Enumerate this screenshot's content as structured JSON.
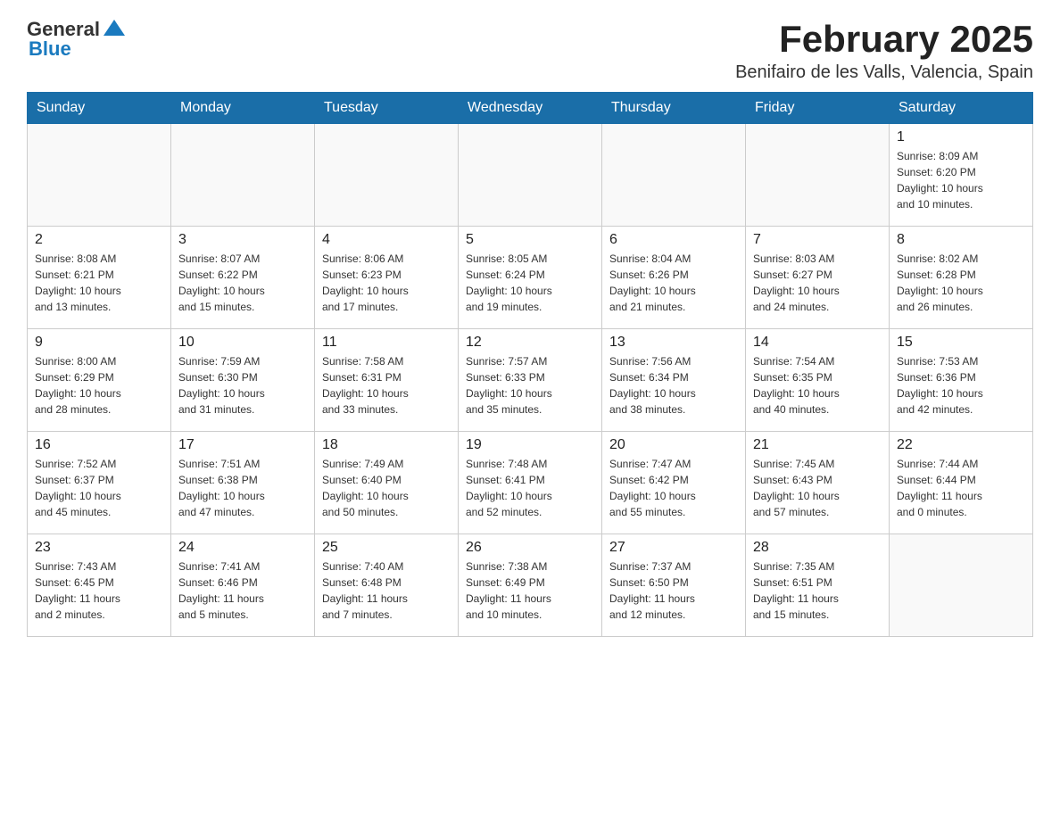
{
  "logo": {
    "general": "General",
    "blue": "Blue"
  },
  "title": "February 2025",
  "subtitle": "Benifairo de les Valls, Valencia, Spain",
  "weekdays": [
    "Sunday",
    "Monday",
    "Tuesday",
    "Wednesday",
    "Thursday",
    "Friday",
    "Saturday"
  ],
  "weeks": [
    [
      {
        "day": "",
        "info": ""
      },
      {
        "day": "",
        "info": ""
      },
      {
        "day": "",
        "info": ""
      },
      {
        "day": "",
        "info": ""
      },
      {
        "day": "",
        "info": ""
      },
      {
        "day": "",
        "info": ""
      },
      {
        "day": "1",
        "info": "Sunrise: 8:09 AM\nSunset: 6:20 PM\nDaylight: 10 hours\nand 10 minutes."
      }
    ],
    [
      {
        "day": "2",
        "info": "Sunrise: 8:08 AM\nSunset: 6:21 PM\nDaylight: 10 hours\nand 13 minutes."
      },
      {
        "day": "3",
        "info": "Sunrise: 8:07 AM\nSunset: 6:22 PM\nDaylight: 10 hours\nand 15 minutes."
      },
      {
        "day": "4",
        "info": "Sunrise: 8:06 AM\nSunset: 6:23 PM\nDaylight: 10 hours\nand 17 minutes."
      },
      {
        "day": "5",
        "info": "Sunrise: 8:05 AM\nSunset: 6:24 PM\nDaylight: 10 hours\nand 19 minutes."
      },
      {
        "day": "6",
        "info": "Sunrise: 8:04 AM\nSunset: 6:26 PM\nDaylight: 10 hours\nand 21 minutes."
      },
      {
        "day": "7",
        "info": "Sunrise: 8:03 AM\nSunset: 6:27 PM\nDaylight: 10 hours\nand 24 minutes."
      },
      {
        "day": "8",
        "info": "Sunrise: 8:02 AM\nSunset: 6:28 PM\nDaylight: 10 hours\nand 26 minutes."
      }
    ],
    [
      {
        "day": "9",
        "info": "Sunrise: 8:00 AM\nSunset: 6:29 PM\nDaylight: 10 hours\nand 28 minutes."
      },
      {
        "day": "10",
        "info": "Sunrise: 7:59 AM\nSunset: 6:30 PM\nDaylight: 10 hours\nand 31 minutes."
      },
      {
        "day": "11",
        "info": "Sunrise: 7:58 AM\nSunset: 6:31 PM\nDaylight: 10 hours\nand 33 minutes."
      },
      {
        "day": "12",
        "info": "Sunrise: 7:57 AM\nSunset: 6:33 PM\nDaylight: 10 hours\nand 35 minutes."
      },
      {
        "day": "13",
        "info": "Sunrise: 7:56 AM\nSunset: 6:34 PM\nDaylight: 10 hours\nand 38 minutes."
      },
      {
        "day": "14",
        "info": "Sunrise: 7:54 AM\nSunset: 6:35 PM\nDaylight: 10 hours\nand 40 minutes."
      },
      {
        "day": "15",
        "info": "Sunrise: 7:53 AM\nSunset: 6:36 PM\nDaylight: 10 hours\nand 42 minutes."
      }
    ],
    [
      {
        "day": "16",
        "info": "Sunrise: 7:52 AM\nSunset: 6:37 PM\nDaylight: 10 hours\nand 45 minutes."
      },
      {
        "day": "17",
        "info": "Sunrise: 7:51 AM\nSunset: 6:38 PM\nDaylight: 10 hours\nand 47 minutes."
      },
      {
        "day": "18",
        "info": "Sunrise: 7:49 AM\nSunset: 6:40 PM\nDaylight: 10 hours\nand 50 minutes."
      },
      {
        "day": "19",
        "info": "Sunrise: 7:48 AM\nSunset: 6:41 PM\nDaylight: 10 hours\nand 52 minutes."
      },
      {
        "day": "20",
        "info": "Sunrise: 7:47 AM\nSunset: 6:42 PM\nDaylight: 10 hours\nand 55 minutes."
      },
      {
        "day": "21",
        "info": "Sunrise: 7:45 AM\nSunset: 6:43 PM\nDaylight: 10 hours\nand 57 minutes."
      },
      {
        "day": "22",
        "info": "Sunrise: 7:44 AM\nSunset: 6:44 PM\nDaylight: 11 hours\nand 0 minutes."
      }
    ],
    [
      {
        "day": "23",
        "info": "Sunrise: 7:43 AM\nSunset: 6:45 PM\nDaylight: 11 hours\nand 2 minutes."
      },
      {
        "day": "24",
        "info": "Sunrise: 7:41 AM\nSunset: 6:46 PM\nDaylight: 11 hours\nand 5 minutes."
      },
      {
        "day": "25",
        "info": "Sunrise: 7:40 AM\nSunset: 6:48 PM\nDaylight: 11 hours\nand 7 minutes."
      },
      {
        "day": "26",
        "info": "Sunrise: 7:38 AM\nSunset: 6:49 PM\nDaylight: 11 hours\nand 10 minutes."
      },
      {
        "day": "27",
        "info": "Sunrise: 7:37 AM\nSunset: 6:50 PM\nDaylight: 11 hours\nand 12 minutes."
      },
      {
        "day": "28",
        "info": "Sunrise: 7:35 AM\nSunset: 6:51 PM\nDaylight: 11 hours\nand 15 minutes."
      },
      {
        "day": "",
        "info": ""
      }
    ]
  ]
}
